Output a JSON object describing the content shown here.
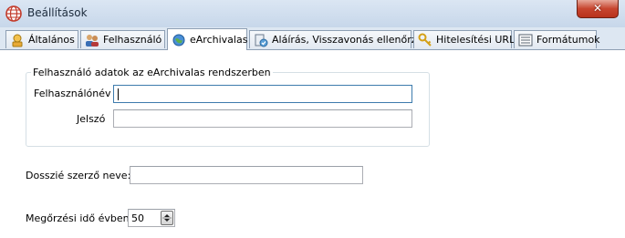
{
  "window": {
    "title": "Beállítások",
    "close_glyph": "✕",
    "app_icon": "settings-globe-icon"
  },
  "tabs": [
    {
      "label": "Általános",
      "icon": "general-settings-icon",
      "active": false
    },
    {
      "label": "Felhasználó",
      "icon": "users-icon",
      "active": false
    },
    {
      "label": "eArchivalas",
      "icon": "archive-globe-icon",
      "active": true
    },
    {
      "label": "Aláírás, Visszavonás ellenőrzés",
      "icon": "signature-check-icon",
      "active": false
    },
    {
      "label": "Hitelesítési URL",
      "icon": "key-icon",
      "active": false
    },
    {
      "label": "Formátumok",
      "icon": "formats-icon",
      "active": false
    }
  ],
  "earchivalas": {
    "group_title": "Felhasználó adatok az eArchivalas rendszerben",
    "username_label": "Felhasználónév",
    "username_value": "",
    "password_label": "Jelszó",
    "password_value": "",
    "dossier_author_label": "Dosszié szerző neve:",
    "dossier_author_value": "",
    "retention_label": "Megőrzési idő évben",
    "retention_value": "50"
  },
  "colors": {
    "titlebar": "#dbe6f3",
    "close_button": "#c7452f",
    "tabstrip": "#dde7f2",
    "focus_border": "#3d7bad"
  }
}
